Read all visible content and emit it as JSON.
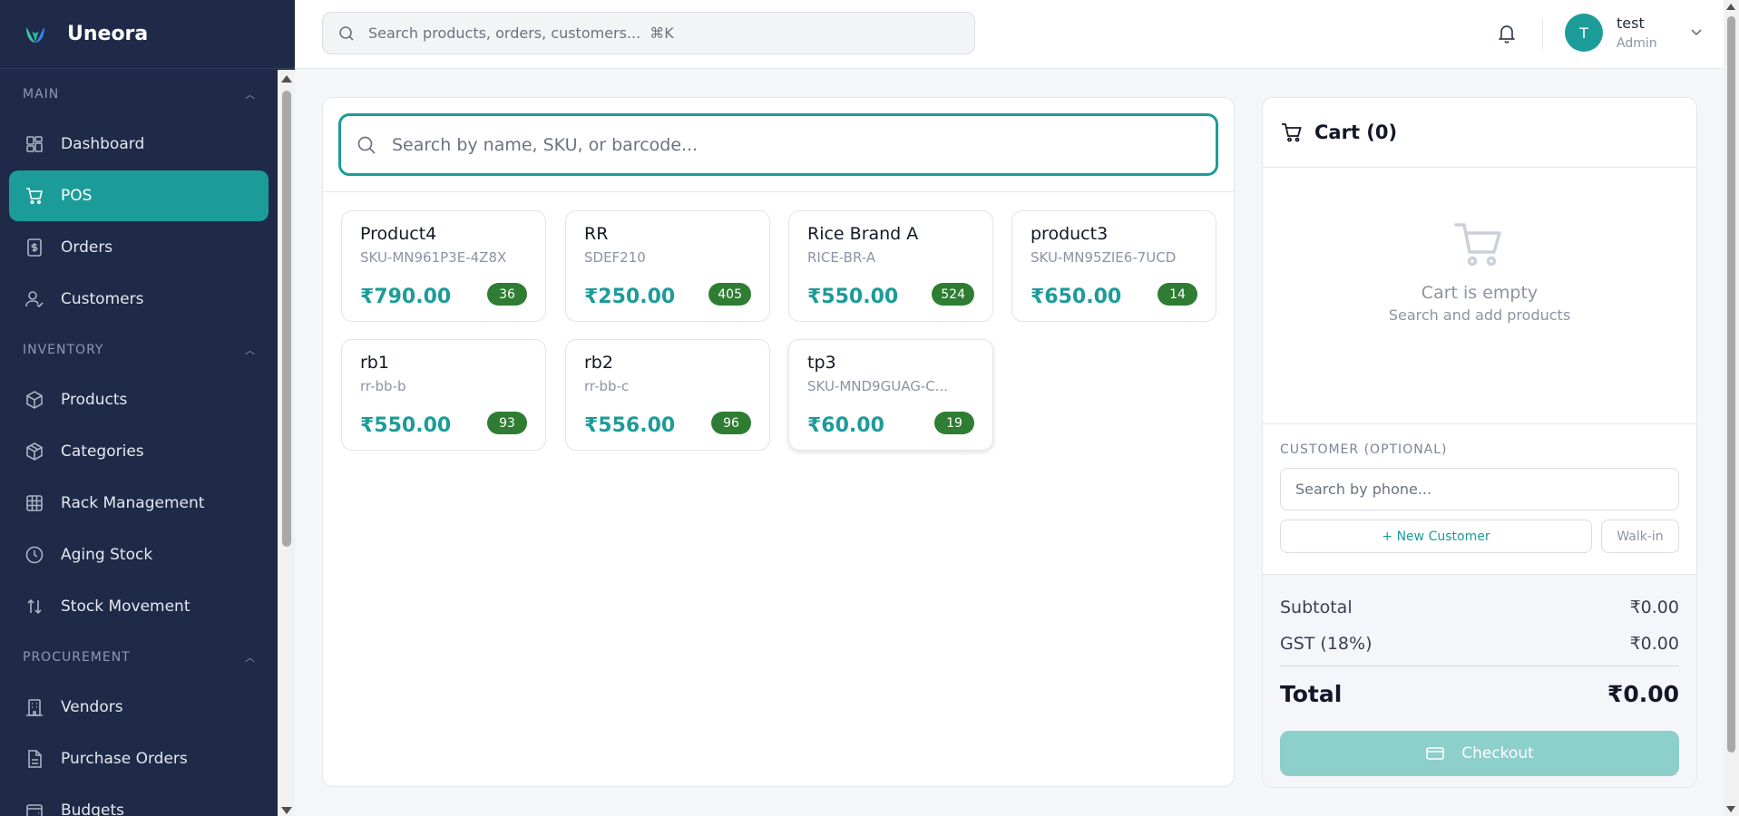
{
  "app": {
    "name": "Uneora"
  },
  "sidebar": {
    "sections": [
      {
        "title": "MAIN",
        "items": [
          "Dashboard",
          "POS",
          "Orders",
          "Customers"
        ]
      },
      {
        "title": "INVENTORY",
        "items": [
          "Products",
          "Categories",
          "Rack Management",
          "Aging Stock",
          "Stock Movement"
        ]
      },
      {
        "title": "PROCUREMENT",
        "items": [
          "Vendors",
          "Purchase Orders",
          "Budgets"
        ]
      }
    ],
    "active_item": "POS"
  },
  "header": {
    "search_placeholder": "Search products, orders, customers...",
    "shortcut": "⌘K",
    "user": {
      "initial": "T",
      "name": "test",
      "role": "Admin"
    }
  },
  "products": {
    "search_placeholder": "Search by name, SKU, or barcode...",
    "items": [
      {
        "name": "Product4",
        "sku": "SKU-MN961P3E-4Z8X",
        "price": "₹790.00",
        "stock": "36"
      },
      {
        "name": "RR",
        "sku": "SDEF210",
        "price": "₹250.00",
        "stock": "405"
      },
      {
        "name": "Rice Brand A",
        "sku": "RICE-BR-A",
        "price": "₹550.00",
        "stock": "524"
      },
      {
        "name": "product3",
        "sku": "SKU-MN95ZIE6-7UCD",
        "price": "₹650.00",
        "stock": "14"
      },
      {
        "name": "rb1",
        "sku": "rr-bb-b",
        "price": "₹550.00",
        "stock": "93"
      },
      {
        "name": "rb2",
        "sku": "rr-bb-c",
        "price": "₹556.00",
        "stock": "96"
      },
      {
        "name": "tp3",
        "sku": "SKU-MND9GUAG-C...",
        "price": "₹60.00",
        "stock": "19"
      }
    ]
  },
  "cart": {
    "title": "Cart (0)",
    "empty_title": "Cart is empty",
    "empty_subtitle": "Search and add products",
    "customer_label": "CUSTOMER (OPTIONAL)",
    "customer_placeholder": "Search by phone...",
    "new_customer_label": "+ New Customer",
    "walkin_label": "Walk-in",
    "subtotal_label": "Subtotal",
    "subtotal_value": "₹0.00",
    "gst_label": "GST (18%)",
    "gst_value": "₹0.00",
    "total_label": "Total",
    "total_value": "₹0.00",
    "checkout_label": "Checkout"
  },
  "colors": {
    "sidebar_bg": "#1e2a47",
    "accent": "#1c9c99",
    "stock_badge": "#2e7d32",
    "checkout_disabled": "#8dcfcb"
  }
}
